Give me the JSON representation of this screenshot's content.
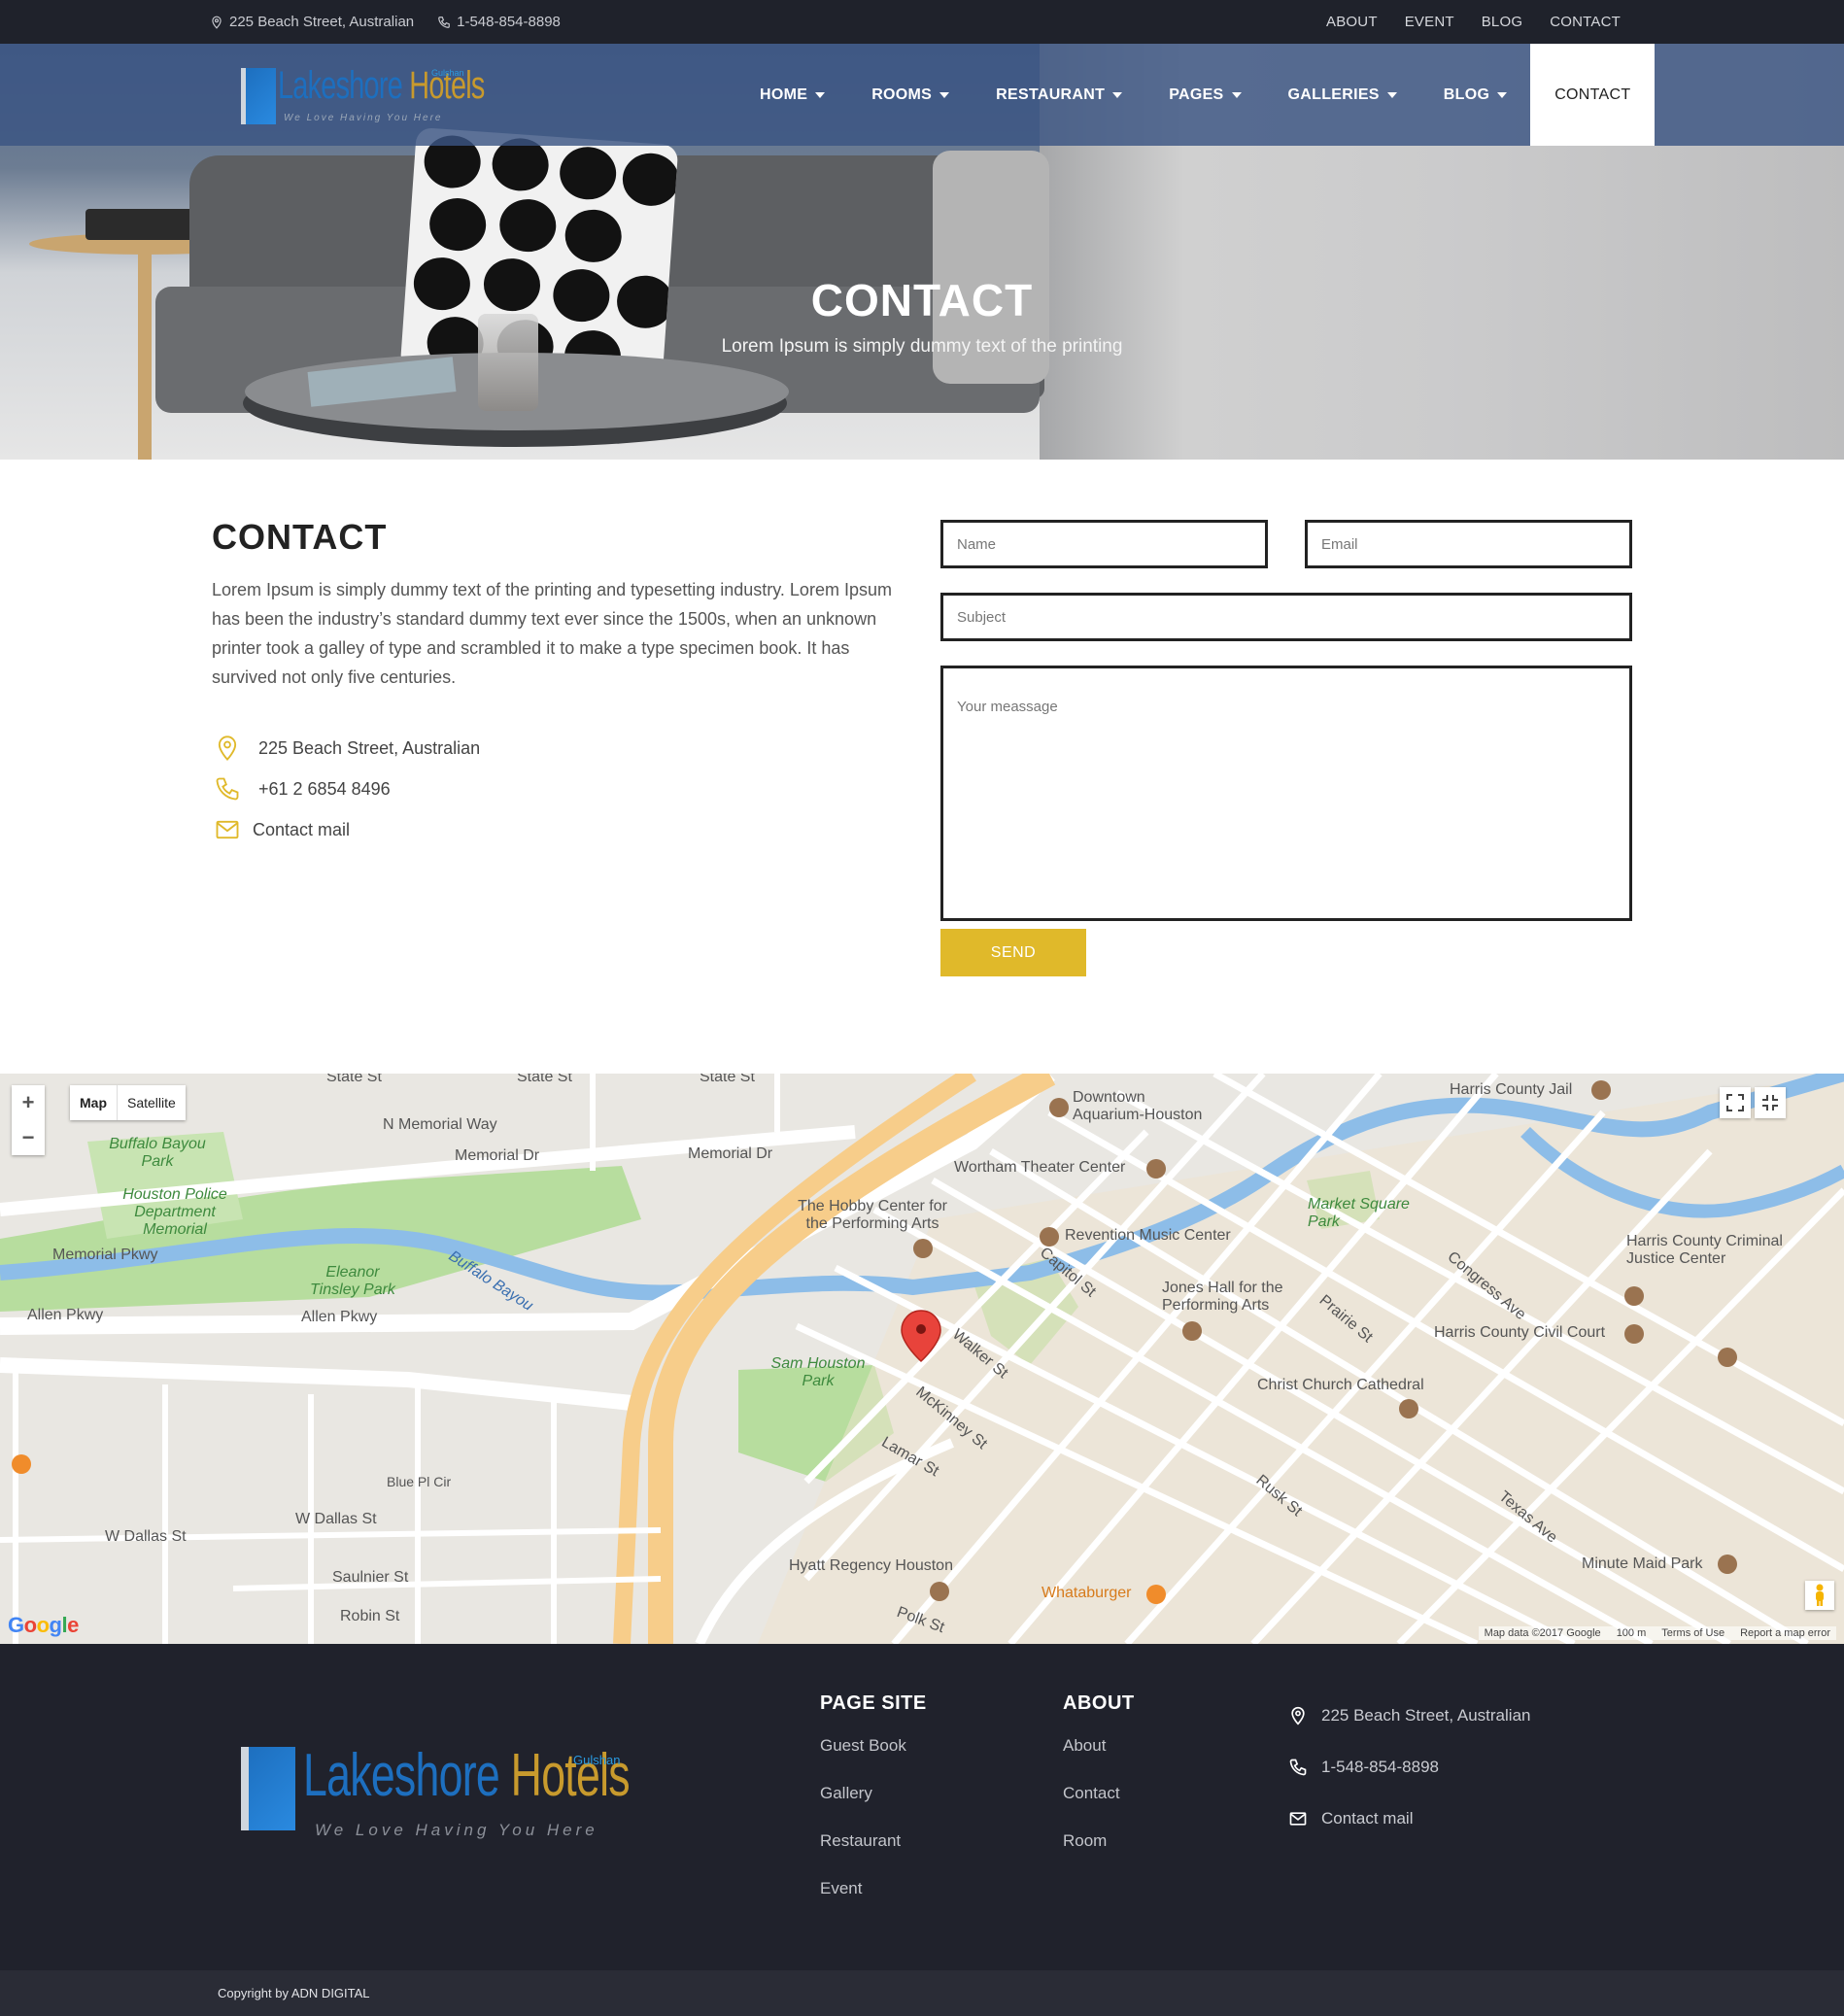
{
  "topbar": {
    "address": "225 Beach Street, Australian",
    "phone": "1-548-854-8898",
    "links": [
      "ABOUT",
      "EVENT",
      "BLOG",
      "CONTACT"
    ]
  },
  "brand": {
    "logo_main": "Lakeshore",
    "logo_accent": "Hotels",
    "tagline": "We Love Having You Here",
    "badge": "Gulshan"
  },
  "nav": {
    "items": [
      "HOME",
      "ROOMS",
      "RESTAURANT",
      "PAGES",
      "GALLERIES",
      "BLOG"
    ],
    "active": "CONTACT"
  },
  "hero": {
    "title": "CONTACT",
    "subtitle": "Lorem Ipsum is simply dummy text of the printing"
  },
  "contact": {
    "title": "CONTACT",
    "description": "Lorem Ipsum is simply dummy text of the printing and typesetting industry. Lorem Ipsum has been the industry’s standard dummy text ever since the 1500s, when an unknown printer took a galley of type and scrambled it to make a type specimen book. It has survived not only five centuries.",
    "address": "225 Beach Street, Australian",
    "phone": "+61 2 6854 8496",
    "mail": "Contact mail"
  },
  "form": {
    "name_placeholder": "Name",
    "email_placeholder": "Email",
    "subject_placeholder": "Subject",
    "message_placeholder": "Your meassage",
    "send_label": "SEND"
  },
  "map": {
    "type_map": "Map",
    "type_satellite": "Satellite",
    "zoom_in": "+",
    "zoom_out": "−",
    "footer_data": "Map data ©2017 Google",
    "footer_scale": "100 m",
    "footer_terms": "Terms of Use",
    "footer_report": "Report a map error",
    "labels": {
      "state1": "State St",
      "state2": "State St",
      "state3": "State St",
      "memorial_way": "N Memorial Way",
      "memorial_dr1": "Memorial Dr",
      "memorial_dr2": "Memorial Dr",
      "memorial_pkwy": "Memorial Pkwy",
      "allen1": "Allen Pkwy",
      "allen2": "Allen Pkwy",
      "buffalo_park": "Buffalo Bayou Park",
      "police": "Houston Police Department Memorial",
      "eleanor": "Eleanor Tinsley Park",
      "buffalo_bayou": "Buffalo Bayou",
      "sam_houston": "Sam Houston Park",
      "hobby": "The Hobby Center for the Performing Arts",
      "wortham": "Wortham Theater Center",
      "revention": "Revention Music Center",
      "jones": "Jones Hall for the Performing Arts",
      "aquarium": "Downtown Aquarium-Houston",
      "market": "Market Square Park",
      "harris_jail": "Harris County Jail",
      "harris_cj": "Harris County Criminal Justice Center",
      "harris_civil": "Harris County Civil Court",
      "christ": "Christ Church Cathedral",
      "minute": "Minute Maid Park",
      "hyatt": "Hyatt Regency Houston",
      "whataburger": "Whataburger",
      "w_dallas1": "W Dallas St",
      "w_dallas2": "W Dallas St",
      "lamar": "Lamar St",
      "mckinney": "McKinney St",
      "walker": "Walker St",
      "capitol": "Capitol St",
      "texas": "Texas Ave",
      "rusk": "Rusk St",
      "polk": "Polk St",
      "saulnier": "Saulnier St",
      "robin": "Robin St",
      "blue_pl": "Blue Pl Cir",
      "congress": "Congress Ave",
      "prairie": "Prairie St"
    }
  },
  "footer": {
    "col1_title": "PAGE SITE",
    "col1_links": [
      "Guest Book",
      "Gallery",
      "Restaurant",
      "Event"
    ],
    "col2_title": "ABOUT",
    "col2_links": [
      "About",
      "Contact",
      "Room"
    ],
    "address": "225 Beach Street, Australian",
    "phone": "1-548-854-8898",
    "mail": "Contact mail",
    "copyright": "Copyright by ADN DIGITAL"
  },
  "colors": {
    "accent": "#e0b92a",
    "dark": "#1f222b",
    "nav_blue": "#3b5482",
    "logo_blue": "#1d6fbf",
    "logo_gold": "#c89a2d"
  }
}
